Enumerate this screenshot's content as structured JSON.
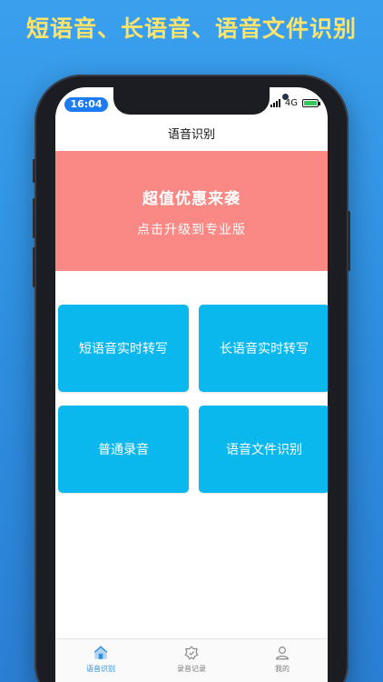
{
  "headline": "短语音、长语音、语音文件识别",
  "status": {
    "time": "16:04",
    "network": "4G"
  },
  "nav": {
    "title": "语音识别"
  },
  "banner": {
    "title": "超值优惠来袭",
    "subtitle": "点击升级到专业版"
  },
  "tiles": [
    {
      "label": "短语音实时转写"
    },
    {
      "label": "长语音实时转写"
    },
    {
      "label": "普通录音"
    },
    {
      "label": "语音文件识别"
    }
  ],
  "tabbar": {
    "items": [
      {
        "label": "语音识别",
        "icon": "house-icon",
        "active": true
      },
      {
        "label": "录音记录",
        "icon": "badge-icon",
        "active": false
      },
      {
        "label": "我的",
        "icon": "person-icon",
        "active": false
      }
    ]
  },
  "colors": {
    "headline": "#ffe36b",
    "banner": "#fa8884",
    "tile": "#0bb8ee",
    "accent": "#2f8fe0"
  }
}
